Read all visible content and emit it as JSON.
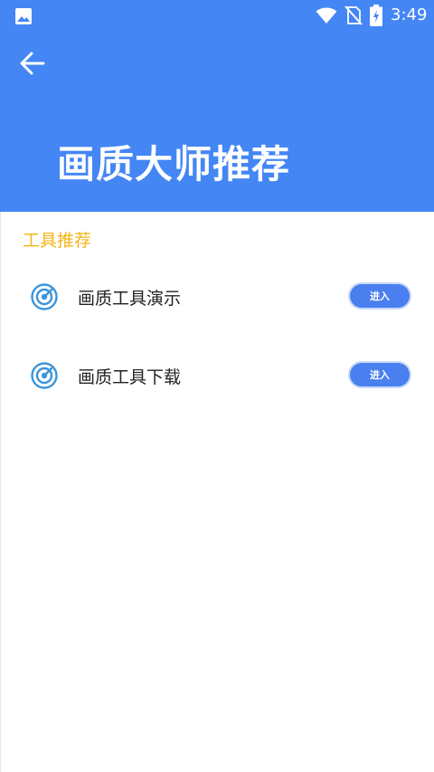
{
  "status_bar": {
    "time": "3:49",
    "icons": [
      "gallery-icon",
      "wifi-icon",
      "no-sim-icon",
      "battery-charging-icon"
    ]
  },
  "header": {
    "title": "画质大师推荐",
    "back_icon": "arrow-left-icon",
    "background": "#4486F4"
  },
  "section": {
    "title": "工具推荐",
    "title_color": "#F5B518"
  },
  "tools": [
    {
      "label": "画质工具演示",
      "icon": "target-icon",
      "button_label": "进入"
    },
    {
      "label": "画质工具下载",
      "icon": "target-icon",
      "button_label": "进入"
    }
  ],
  "colors": {
    "accent": "#4486F4",
    "button": "#4A7FEF",
    "icon": "#3B95DB"
  }
}
